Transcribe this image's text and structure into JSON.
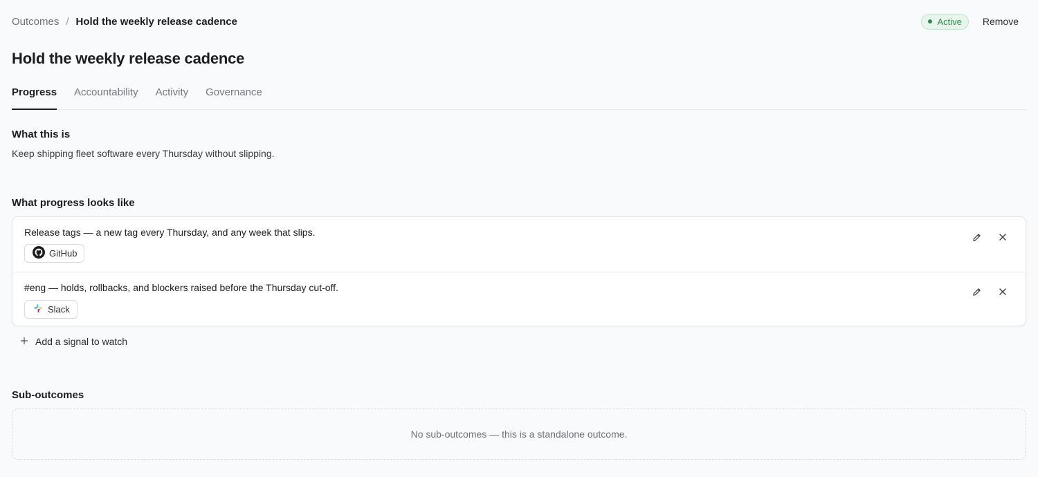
{
  "breadcrumb": {
    "parent": "Outcomes",
    "separator": "/",
    "current": "Hold the weekly release cadence"
  },
  "status": {
    "label": "Active",
    "color": "#2f8a4f"
  },
  "actions": {
    "remove_label": "Remove"
  },
  "page": {
    "title": "Hold the weekly release cadence"
  },
  "tabs": [
    {
      "label": "Progress",
      "active": true
    },
    {
      "label": "Accountability",
      "active": false
    },
    {
      "label": "Activity",
      "active": false
    },
    {
      "label": "Governance",
      "active": false
    }
  ],
  "about": {
    "heading": "What this is",
    "text": "Keep shipping fleet software every Thursday without slipping."
  },
  "progress": {
    "heading": "What progress looks like",
    "signals": [
      {
        "description": "Release tags — a new tag every Thursday, and any week that slips.",
        "source": "GitHub",
        "icon": "github-icon"
      },
      {
        "description": "#eng — holds, rollbacks, and blockers raised before the Thursday cut-off.",
        "source": "Slack",
        "icon": "slack-icon"
      }
    ],
    "add_label": "Add a signal to watch"
  },
  "sub_outcomes": {
    "heading": "Sub-outcomes",
    "empty_text": "No sub-outcomes — this is a standalone outcome."
  }
}
